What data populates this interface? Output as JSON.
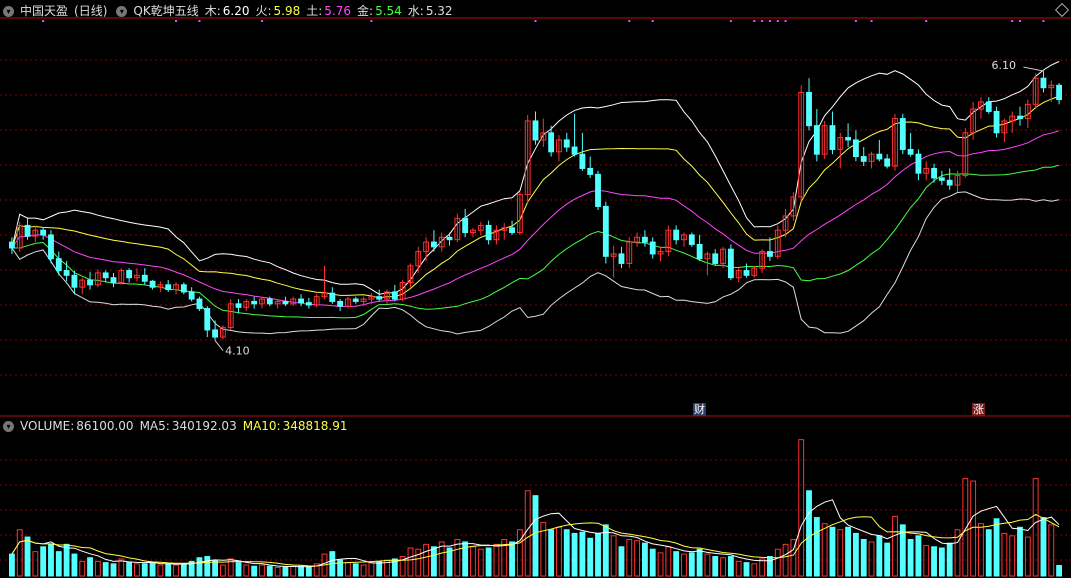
{
  "header": {
    "stock_name": "中国天盈",
    "period": "(日线)",
    "indicator_name": "QK乾坤五线",
    "lines": [
      {
        "label": "木:",
        "value": "6.20",
        "color": "#ffffff"
      },
      {
        "label": "火:",
        "value": "5.98",
        "color": "#ffff44"
      },
      {
        "label": "土:",
        "value": "5.76",
        "color": "#ff44ff"
      },
      {
        "label": "金:",
        "value": "5.54",
        "color": "#44ff44"
      },
      {
        "label": "水:",
        "value": "5.32",
        "color": "#dddddd"
      }
    ]
  },
  "volume_header": {
    "volume": {
      "label": "VOLUME:",
      "value": "86100.00",
      "color": "#dddddd"
    },
    "ma5": {
      "label": "MA5:",
      "value": "340192.03",
      "color": "#dddddd"
    },
    "ma10": {
      "label": "MA10:",
      "value": "348818.91",
      "color": "#ffff44"
    }
  },
  "annotations": {
    "low_label": "4.10",
    "high_label": "6.10",
    "finance_tag": "财",
    "rise_tag": "涨"
  },
  "colors": {
    "up": "#ff3232",
    "down": "#54ffff",
    "grid": "#8b0000",
    "background": "#000000",
    "signal_dot": "#ff44ff"
  },
  "chart_data": {
    "type": "candlestick",
    "price_range": [
      3.55,
      6.75
    ],
    "volume_range": [
      0,
      1150000
    ],
    "candles": [
      [
        4.88,
        4.92,
        4.78,
        4.83,
        180000
      ],
      [
        4.83,
        5.05,
        4.8,
        5.02,
        380000
      ],
      [
        5.02,
        5.08,
        4.9,
        4.93,
        320000
      ],
      [
        4.93,
        5.02,
        4.88,
        4.98,
        200000
      ],
      [
        4.98,
        5.0,
        4.9,
        4.94,
        240000
      ],
      [
        4.94,
        4.98,
        4.7,
        4.74,
        260000
      ],
      [
        4.74,
        4.8,
        4.6,
        4.64,
        200000
      ],
      [
        4.64,
        4.72,
        4.55,
        4.6,
        260000
      ],
      [
        4.6,
        4.64,
        4.44,
        4.5,
        180000
      ],
      [
        4.5,
        4.58,
        4.44,
        4.56,
        120000
      ],
      [
        4.56,
        4.63,
        4.48,
        4.52,
        150000
      ],
      [
        4.52,
        4.65,
        4.5,
        4.62,
        120000
      ],
      [
        4.62,
        4.64,
        4.54,
        4.58,
        110000
      ],
      [
        4.58,
        4.62,
        4.5,
        4.54,
        100000
      ],
      [
        4.54,
        4.66,
        4.52,
        4.64,
        140000
      ],
      [
        4.64,
        4.66,
        4.54,
        4.58,
        110000
      ],
      [
        4.58,
        4.66,
        4.55,
        4.6,
        100000
      ],
      [
        4.6,
        4.66,
        4.52,
        4.55,
        100000
      ],
      [
        4.55,
        4.56,
        4.48,
        4.5,
        110000
      ],
      [
        4.5,
        4.55,
        4.46,
        4.52,
        90000
      ],
      [
        4.52,
        4.56,
        4.46,
        4.48,
        100000
      ],
      [
        4.48,
        4.54,
        4.44,
        4.52,
        90000
      ],
      [
        4.52,
        4.54,
        4.44,
        4.46,
        100000
      ],
      [
        4.46,
        4.5,
        4.38,
        4.4,
        120000
      ],
      [
        4.4,
        4.42,
        4.3,
        4.32,
        150000
      ],
      [
        4.32,
        4.34,
        4.08,
        4.14,
        160000
      ],
      [
        4.14,
        4.22,
        4.05,
        4.08,
        130000
      ],
      [
        4.08,
        4.18,
        4.06,
        4.16,
        90000
      ],
      [
        4.16,
        4.4,
        4.14,
        4.36,
        140000
      ],
      [
        4.36,
        4.4,
        4.28,
        4.33,
        110000
      ],
      [
        4.33,
        4.4,
        4.3,
        4.38,
        90000
      ],
      [
        4.38,
        4.42,
        4.32,
        4.36,
        80000
      ],
      [
        4.36,
        4.42,
        4.32,
        4.4,
        90000
      ],
      [
        4.4,
        4.42,
        4.34,
        4.36,
        80000
      ],
      [
        4.36,
        4.4,
        4.32,
        4.38,
        70000
      ],
      [
        4.38,
        4.42,
        4.34,
        4.36,
        70000
      ],
      [
        4.36,
        4.42,
        4.34,
        4.4,
        80000
      ],
      [
        4.4,
        4.44,
        4.34,
        4.37,
        80000
      ],
      [
        4.37,
        4.41,
        4.32,
        4.35,
        80000
      ],
      [
        4.35,
        4.44,
        4.33,
        4.42,
        100000
      ],
      [
        4.42,
        4.68,
        4.4,
        4.45,
        180000
      ],
      [
        4.45,
        4.5,
        4.36,
        4.38,
        200000
      ],
      [
        4.38,
        4.4,
        4.3,
        4.34,
        130000
      ],
      [
        4.34,
        4.42,
        4.32,
        4.4,
        110000
      ],
      [
        4.4,
        4.42,
        4.36,
        4.38,
        100000
      ],
      [
        4.38,
        4.42,
        4.34,
        4.4,
        90000
      ],
      [
        4.4,
        4.45,
        4.36,
        4.42,
        110000
      ],
      [
        4.42,
        4.48,
        4.38,
        4.4,
        120000
      ],
      [
        4.4,
        4.48,
        4.36,
        4.46,
        130000
      ],
      [
        4.46,
        4.52,
        4.38,
        4.4,
        140000
      ],
      [
        4.4,
        4.56,
        4.38,
        4.54,
        160000
      ],
      [
        4.54,
        4.7,
        4.5,
        4.68,
        230000
      ],
      [
        4.68,
        4.84,
        4.62,
        4.8,
        220000
      ],
      [
        4.8,
        4.92,
        4.72,
        4.88,
        260000
      ],
      [
        4.88,
        4.98,
        4.8,
        4.84,
        240000
      ],
      [
        4.84,
        4.96,
        4.8,
        4.92,
        280000
      ],
      [
        4.92,
        4.96,
        4.85,
        4.9,
        230000
      ],
      [
        4.9,
        5.12,
        4.88,
        5.08,
        300000
      ],
      [
        5.08,
        5.16,
        4.92,
        4.96,
        280000
      ],
      [
        4.96,
        5.0,
        4.92,
        4.98,
        240000
      ],
      [
        4.98,
        5.05,
        4.94,
        5.02,
        220000
      ],
      [
        5.02,
        5.06,
        4.86,
        4.9,
        230000
      ],
      [
        4.9,
        5.02,
        4.86,
        4.98,
        260000
      ],
      [
        4.98,
        5.04,
        4.9,
        5.0,
        300000
      ],
      [
        5.0,
        5.06,
        4.94,
        4.96,
        280000
      ],
      [
        4.96,
        5.3,
        4.94,
        5.28,
        380000
      ],
      [
        5.28,
        5.95,
        5.2,
        5.9,
        700000
      ],
      [
        5.9,
        5.98,
        5.7,
        5.74,
        660000
      ],
      [
        5.74,
        5.92,
        5.68,
        5.8,
        440000
      ],
      [
        5.8,
        5.86,
        5.6,
        5.64,
        380000
      ],
      [
        5.64,
        5.78,
        5.56,
        5.74,
        400000
      ],
      [
        5.74,
        5.8,
        5.64,
        5.68,
        380000
      ],
      [
        5.68,
        5.96,
        5.6,
        5.62,
        350000
      ],
      [
        5.62,
        5.8,
        5.48,
        5.5,
        360000
      ],
      [
        5.5,
        5.6,
        5.42,
        5.45,
        310000
      ],
      [
        5.45,
        5.48,
        5.15,
        5.18,
        350000
      ],
      [
        5.18,
        5.22,
        4.7,
        4.76,
        420000
      ],
      [
        4.76,
        4.85,
        4.58,
        4.78,
        330000
      ],
      [
        4.78,
        4.84,
        4.66,
        4.7,
        240000
      ],
      [
        4.7,
        4.92,
        4.66,
        4.88,
        300000
      ],
      [
        4.88,
        4.96,
        4.84,
        4.92,
        290000
      ],
      [
        4.92,
        4.98,
        4.84,
        4.88,
        270000
      ],
      [
        4.88,
        4.92,
        4.74,
        4.78,
        220000
      ],
      [
        4.78,
        4.84,
        4.72,
        4.8,
        190000
      ],
      [
        4.8,
        5.02,
        4.76,
        4.98,
        240000
      ],
      [
        4.98,
        5.02,
        4.86,
        4.9,
        200000
      ],
      [
        4.9,
        4.96,
        4.84,
        4.94,
        180000
      ],
      [
        4.94,
        4.96,
        4.84,
        4.86,
        190000
      ],
      [
        4.86,
        4.94,
        4.72,
        4.74,
        220000
      ],
      [
        4.74,
        4.8,
        4.6,
        4.78,
        180000
      ],
      [
        4.78,
        4.82,
        4.68,
        4.7,
        160000
      ],
      [
        4.7,
        4.84,
        4.66,
        4.82,
        150000
      ],
      [
        4.82,
        4.86,
        4.56,
        4.58,
        160000
      ],
      [
        4.58,
        4.66,
        4.54,
        4.64,
        120000
      ],
      [
        4.64,
        4.7,
        4.58,
        4.6,
        110000
      ],
      [
        4.6,
        4.68,
        4.58,
        4.66,
        100000
      ],
      [
        4.66,
        4.82,
        4.62,
        4.8,
        140000
      ],
      [
        4.8,
        4.92,
        4.72,
        4.76,
        160000
      ],
      [
        4.76,
        5.02,
        4.74,
        4.98,
        220000
      ],
      [
        4.98,
        5.16,
        4.92,
        5.1,
        260000
      ],
      [
        5.1,
        5.3,
        5.06,
        5.26,
        300000
      ],
      [
        5.26,
        6.2,
        5.22,
        6.14,
        1120000
      ],
      [
        6.14,
        6.26,
        5.82,
        5.86,
        700000
      ],
      [
        5.86,
        6.0,
        5.56,
        5.62,
        480000
      ],
      [
        5.62,
        5.9,
        5.58,
        5.86,
        430000
      ],
      [
        5.86,
        5.98,
        5.62,
        5.66,
        400000
      ],
      [
        5.66,
        5.8,
        5.5,
        5.76,
        380000
      ],
      [
        5.76,
        5.88,
        5.68,
        5.74,
        400000
      ],
      [
        5.74,
        5.82,
        5.56,
        5.6,
        350000
      ],
      [
        5.6,
        5.68,
        5.52,
        5.56,
        300000
      ],
      [
        5.56,
        5.64,
        5.5,
        5.62,
        280000
      ],
      [
        5.62,
        5.74,
        5.56,
        5.58,
        330000
      ],
      [
        5.58,
        5.62,
        5.5,
        5.52,
        270000
      ],
      [
        5.52,
        5.96,
        5.48,
        5.92,
        490000
      ],
      [
        5.92,
        5.96,
        5.62,
        5.66,
        420000
      ],
      [
        5.66,
        5.8,
        5.6,
        5.62,
        300000
      ],
      [
        5.62,
        5.66,
        5.4,
        5.46,
        330000
      ],
      [
        5.46,
        5.56,
        5.4,
        5.5,
        250000
      ],
      [
        5.5,
        5.54,
        5.38,
        5.42,
        240000
      ],
      [
        5.42,
        5.48,
        5.36,
        5.4,
        230000
      ],
      [
        5.4,
        5.5,
        5.32,
        5.36,
        270000
      ],
      [
        5.36,
        5.48,
        5.3,
        5.44,
        380000
      ],
      [
        5.44,
        5.84,
        5.42,
        5.8,
        800000
      ],
      [
        5.8,
        6.06,
        5.74,
        6.0,
        780000
      ],
      [
        6.0,
        6.1,
        5.92,
        6.06,
        430000
      ],
      [
        6.06,
        6.1,
        5.96,
        5.98,
        380000
      ],
      [
        5.98,
        6.02,
        5.76,
        5.8,
        470000
      ],
      [
        5.8,
        5.92,
        5.72,
        5.9,
        350000
      ],
      [
        5.9,
        5.98,
        5.8,
        5.94,
        330000
      ],
      [
        5.94,
        6.02,
        5.86,
        5.92,
        400000
      ],
      [
        5.92,
        6.08,
        5.84,
        6.04,
        320000
      ],
      [
        6.04,
        6.3,
        6.0,
        6.26,
        800000
      ],
      [
        6.26,
        6.32,
        6.14,
        6.18,
        480000
      ],
      [
        6.18,
        6.24,
        6.06,
        6.2,
        420000
      ],
      [
        6.2,
        6.22,
        6.04,
        6.08,
        86100
      ]
    ],
    "signal_dots": [
      [
        4,
        5.76
      ],
      [
        21,
        5.76
      ],
      [
        24,
        5.76
      ],
      [
        32,
        5.76
      ],
      [
        46,
        5.76
      ],
      [
        67,
        5.76
      ],
      [
        79,
        5.76
      ],
      [
        82,
        5.76
      ],
      [
        92,
        5.76
      ],
      [
        95,
        5.76
      ],
      [
        96,
        5.76
      ],
      [
        97,
        5.76
      ],
      [
        98,
        5.76
      ],
      [
        99,
        5.76
      ],
      [
        108,
        5.76
      ],
      [
        110,
        5.76
      ],
      [
        117,
        5.76
      ],
      [
        128,
        5.76
      ],
      [
        129,
        5.76
      ],
      [
        132,
        5.76
      ],
      [
        138,
        5.76
      ]
    ]
  }
}
